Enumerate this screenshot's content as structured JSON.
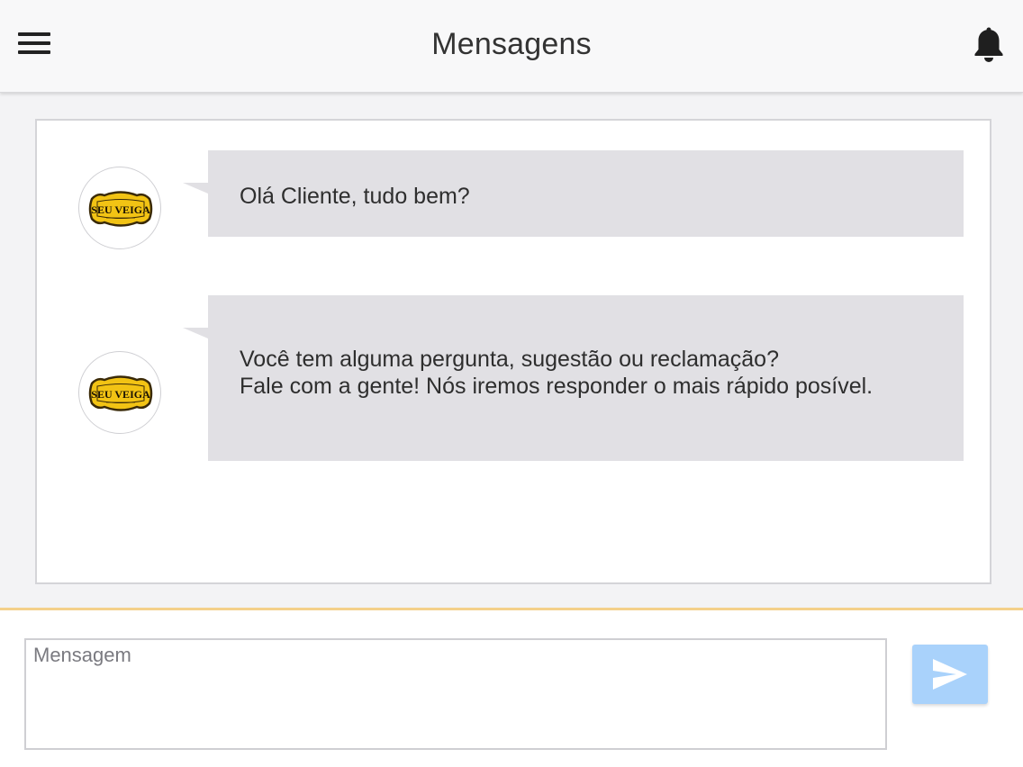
{
  "header": {
    "title": "Mensagens",
    "menu_icon": "hamburger-menu-icon",
    "notification_icon": "bell-icon"
  },
  "messages": [
    {
      "sender_logo_text": "SEU VEIGA",
      "lines": [
        "Olá Cliente, tudo bem?"
      ]
    },
    {
      "sender_logo_text": "SEU VEIGA",
      "lines": [
        "Você tem alguma pergunta, sugestão ou reclamação?",
        "Fale com a gente! Nós iremos responder o mais rápido posível."
      ]
    }
  ],
  "compose": {
    "placeholder": "Mensagem",
    "value": "",
    "send_icon": "send-arrow-icon"
  },
  "colors": {
    "header_bg": "#f8f8f9",
    "bubble_bg": "#e1e0e4",
    "send_button": "#a9d2fb",
    "accent_border": "#f4d08a",
    "logo_yellow": "#f2c314"
  }
}
